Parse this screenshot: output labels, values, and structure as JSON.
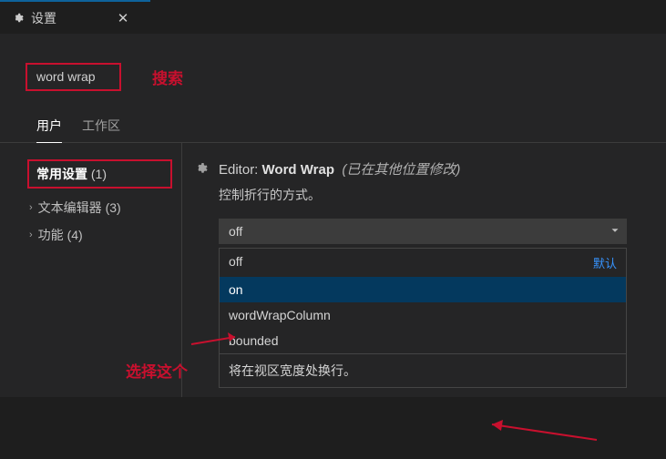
{
  "titlebar": {
    "title": "设置"
  },
  "search": {
    "value": "word wrap"
  },
  "annotations": {
    "search": "搜索",
    "select": "选择这个"
  },
  "tabs": {
    "user": "用户",
    "workspace": "工作区"
  },
  "toc": {
    "common_label": "常用设置",
    "common_count": "(1)",
    "text_editor_label": "文本编辑器",
    "text_editor_count": "(3)",
    "features_label": "功能",
    "features_count": "(4)"
  },
  "setting": {
    "scope": "Editor:",
    "key": "Word Wrap",
    "modified": "(已在其他位置修改)",
    "description": "控制折行的方式。",
    "current": "off",
    "options": {
      "off": "off",
      "on": "on",
      "wordWrapColumn": "wordWrapColumn",
      "bounded": "bounded"
    },
    "default_badge": "默认",
    "hint": "将在视区宽度处换行。"
  }
}
